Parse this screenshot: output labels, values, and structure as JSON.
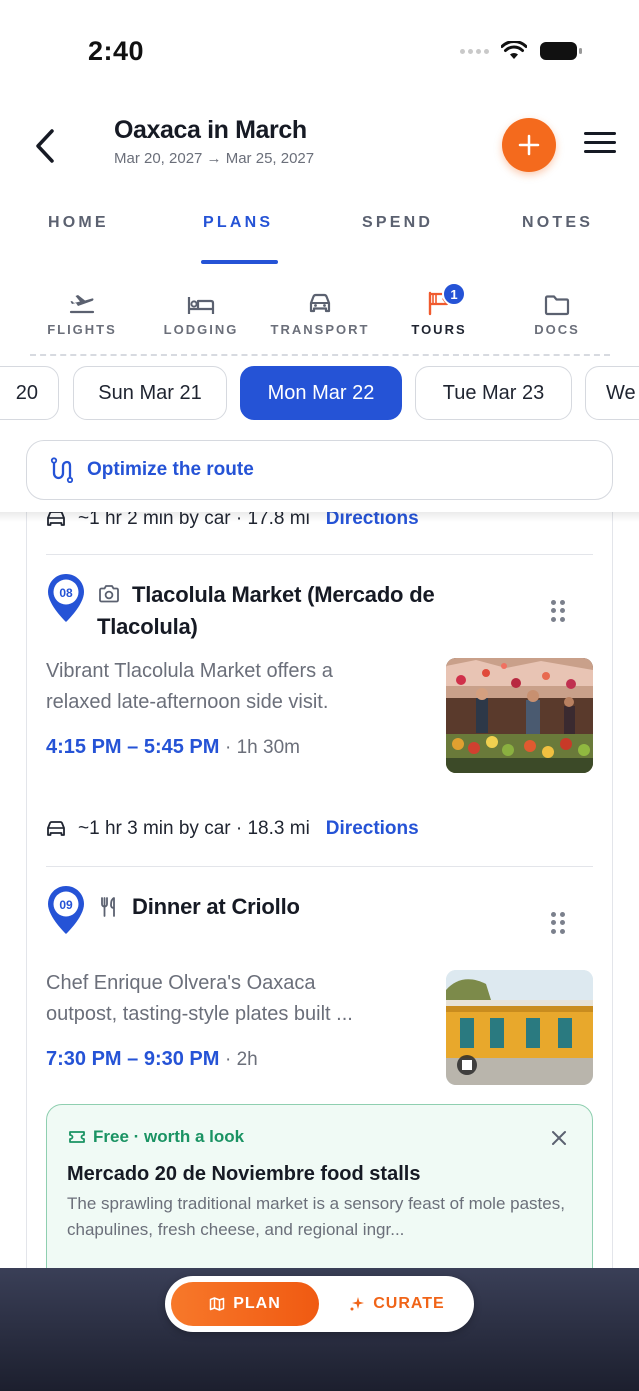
{
  "status_bar": {
    "time": "2:40"
  },
  "header": {
    "title": "Oaxaca in March",
    "dates": "Mar 20, 2027 → Mar 25, 2027",
    "add_label": "+"
  },
  "main_tabs": [
    {
      "label": "HOME",
      "active": false
    },
    {
      "label": "PLANS",
      "active": true
    },
    {
      "label": "SPEND",
      "active": false
    },
    {
      "label": "NOTES",
      "active": false
    }
  ],
  "sub_tabs": [
    {
      "label": "FLIGHTS",
      "icon": "plane-icon"
    },
    {
      "label": "LODGING",
      "icon": "bed-icon"
    },
    {
      "label": "TRANSPORT",
      "icon": "car-icon"
    },
    {
      "label": "TOURS",
      "icon": "flag-icon",
      "active": true,
      "badge": "1"
    },
    {
      "label": "DOCS",
      "icon": "folder-icon"
    }
  ],
  "dates": [
    {
      "label": "20"
    },
    {
      "label": "Sun Mar 21"
    },
    {
      "label": "Mon Mar 22",
      "active": true
    },
    {
      "label": "Tue Mar 23"
    },
    {
      "label": "We"
    }
  ],
  "optimize": {
    "label": "Optimize the route"
  },
  "itinerary": {
    "travel_prev": {
      "text": "~1 hr 2 min by car · 17.8 mi",
      "directions": "Directions"
    },
    "stop_08": {
      "number": "08",
      "icon": "camera-icon",
      "title_line1": "Tlacolula Market (Mercado de",
      "title_line2": "Tlacolula)",
      "desc_line1": "Vibrant Tlacolula Market offers a",
      "desc_line2": "relaxed late-afternoon side visit.",
      "time": "4:15 PM – 5:45 PM",
      "duration": "· 1h 30m"
    },
    "travel_08_09": {
      "text": "~1 hr 3 min by car · 18.3 mi",
      "directions": "Directions"
    },
    "stop_09": {
      "number": "09",
      "icon": "fork-knife-icon",
      "title": "Dinner at Criollo",
      "desc_line1": "Chef Enrique Olvera's Oaxaca",
      "desc_line2": "outpost, tasting-style plates built ...",
      "time": "7:30 PM – 9:30 PM",
      "duration": "· 2h"
    }
  },
  "suggestion": {
    "tag": "Free · worth a look",
    "title": "Mercado 20 de Noviembre food stalls",
    "desc": "The sprawling traditional market is a sensory feast of mole pastes, chapulines, fresh cheese, and regional ingr..."
  },
  "bottom_bar": {
    "plan_label": "PLAN",
    "curate_label": "CURATE"
  },
  "colors": {
    "accent_blue": "#2553d6",
    "accent_orange": "#f46a1d",
    "suggestion_green": "#1a9363"
  }
}
